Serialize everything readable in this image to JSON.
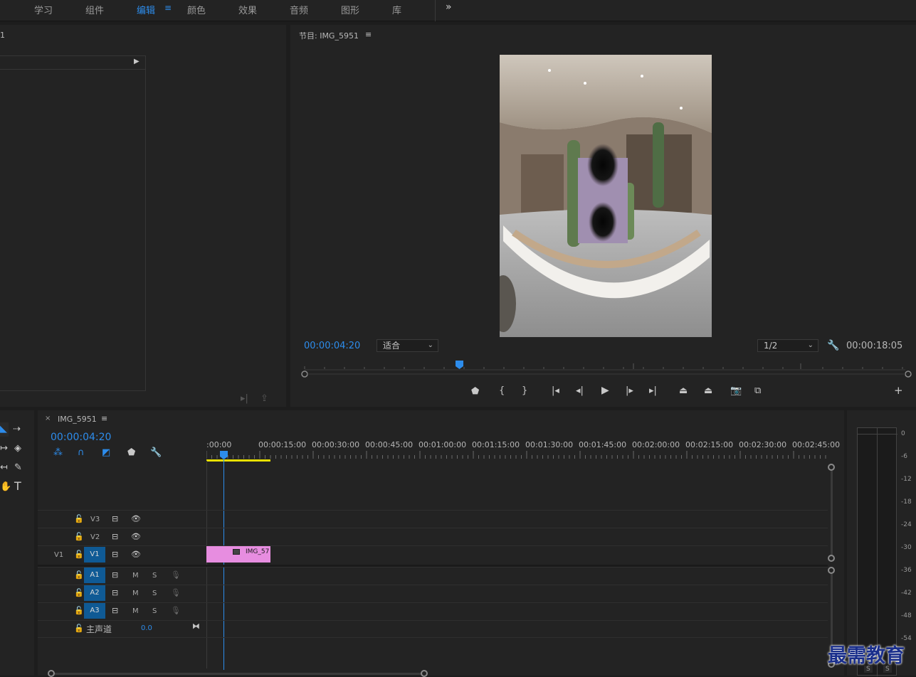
{
  "workspace_tabs": [
    {
      "label": "学习",
      "active": false
    },
    {
      "label": "组件",
      "active": false
    },
    {
      "label": "编辑",
      "active": true
    },
    {
      "label": "颜色",
      "active": false
    },
    {
      "label": "效果",
      "active": false
    },
    {
      "label": "音频",
      "active": false
    },
    {
      "label": "图形",
      "active": false
    },
    {
      "label": "库",
      "active": false
    }
  ],
  "source_panel": {
    "title_fragment": "1"
  },
  "program_monitor": {
    "title": "节目: IMG_5951",
    "current_time": "00:00:04:20",
    "zoom": "适合",
    "resolution": "1/2",
    "duration": "00:00:18:05",
    "playhead_fraction": 0.2
  },
  "timeline": {
    "tab_label": "IMG_5951",
    "current_time": "00:00:04:20",
    "ruler_labels": [
      ":00:00",
      "00:00:15:00",
      "00:00:30:00",
      "00:00:45:00",
      "00:01:00:00",
      "00:01:15:00",
      "00:01:30:00",
      "00:01:45:00",
      "00:02:00:00",
      "00:02:15:00",
      "00:02:30:00",
      "00:02:45:00"
    ],
    "video_tracks": [
      {
        "name": "V3",
        "source": ""
      },
      {
        "name": "V2",
        "source": ""
      },
      {
        "name": "V1",
        "source": "V1"
      }
    ],
    "audio_tracks": [
      {
        "name": "A1",
        "mute": "M",
        "solo": "S"
      },
      {
        "name": "A2",
        "mute": "M",
        "solo": "S"
      },
      {
        "name": "A3",
        "mute": "M",
        "solo": "S"
      }
    ],
    "master": {
      "label": "主声道",
      "value": "0.0"
    },
    "clip": {
      "label": "IMG_57",
      "color": "#e78de0"
    }
  },
  "audio_meter": {
    "scale": [
      "0",
      "-6",
      "-12",
      "-18",
      "-24",
      "-30",
      "-36",
      "-42",
      "-48",
      "-54"
    ],
    "solo_labels": [
      "S",
      "S"
    ]
  },
  "watermark": "最需教育",
  "colors": {
    "accent": "#2d8ceb",
    "clip": "#e78de0",
    "work_area": "#e8e000"
  }
}
